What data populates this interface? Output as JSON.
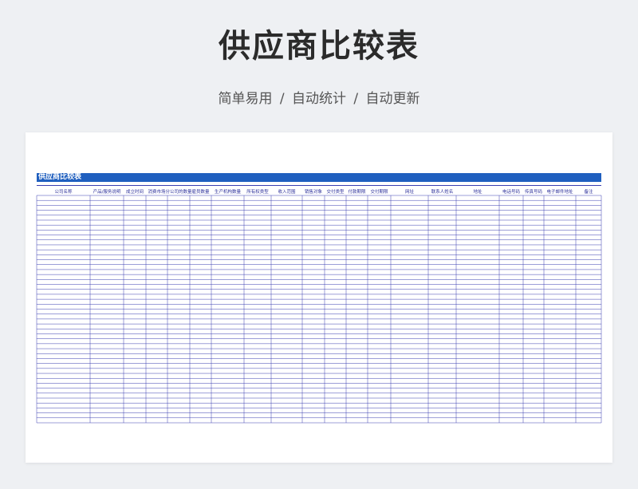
{
  "header": {
    "title": "供应商比较表",
    "subtitle": "简单易用 / 自动统计 / 自动更新"
  },
  "sheet": {
    "banner_title": "供应商比较表",
    "columns": [
      "公司名称",
      "产品/服务说明",
      "成立时间",
      "消费市场",
      "分公司的数量",
      "雇员数量",
      "生产机构数量",
      "所有权类型",
      "收入范围",
      "销售对象",
      "交付类型",
      "付款期限",
      "交付期限",
      "网址",
      "联系人姓名",
      "地址",
      "电话号码",
      "传真号码",
      "电子邮件地址",
      "备注"
    ],
    "row_count": 46
  },
  "colors": {
    "banner": "#1f5fbf",
    "grid_line": "#3b3fb0",
    "header_text": "#2b2f9a"
  }
}
